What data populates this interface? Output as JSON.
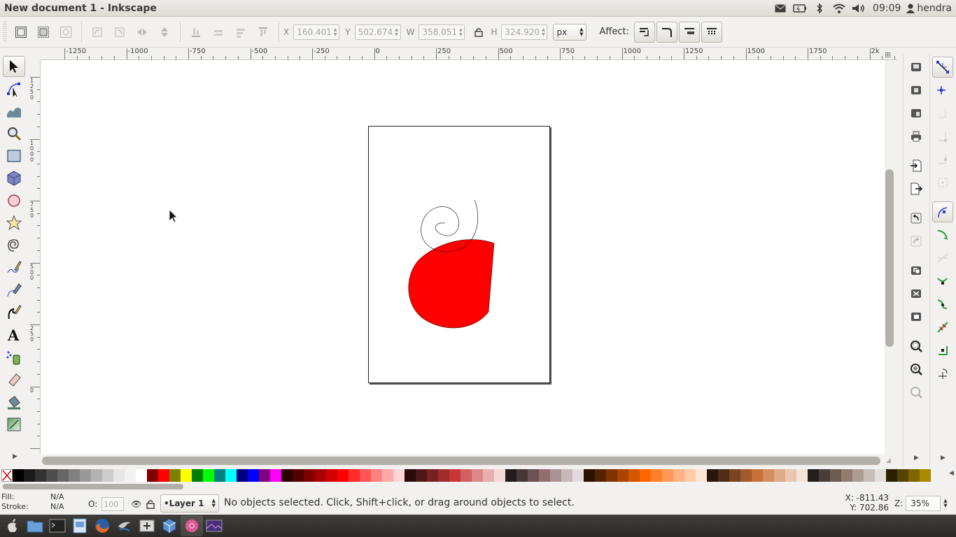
{
  "window": {
    "title": "New document 1 - Inkscape"
  },
  "tray": {
    "clock": "09:09",
    "user": "hendra"
  },
  "controls": {
    "x_label": "X",
    "x_value": "160.401",
    "y_label": "Y",
    "y_value": "502.674",
    "w_label": "W",
    "w_value": "358.051",
    "h_label": "H",
    "h_value": "324.920",
    "unit": "px",
    "affect_label": "Affect:"
  },
  "ruler": {
    "h_ticks": [
      "-1250",
      "-1000",
      "-750",
      "-500",
      "-250",
      "0",
      "250",
      "500",
      "750",
      "1000",
      "1250",
      "1500",
      "1750",
      "2k"
    ],
    "v_ticks": [
      "1250",
      "1000",
      "750",
      "500",
      "250",
      "0"
    ]
  },
  "statusbar": {
    "fill_label": "Fill:",
    "fill_value": "N/A",
    "stroke_label": "Stroke:",
    "stroke_value": "N/A",
    "opacity_label": "O:",
    "opacity_value": "100",
    "layer": "•Layer 1",
    "message": "No objects selected. Click, Shift+click, or drag around objects to select.",
    "x_coord": "X: -811.43",
    "y_coord": "Y:  702.86",
    "zoom_label": "Z:",
    "zoom_value": "35%"
  },
  "palette": [
    "#000000",
    "#1a1a1a",
    "#333333",
    "#4d4d4d",
    "#666666",
    "#808080",
    "#999999",
    "#b3b3b3",
    "#cccccc",
    "#e6e6e6",
    "#f2f2f2",
    "#ffffff",
    "#800000",
    "#ff0000",
    "#808000",
    "#ffff00",
    "#008000",
    "#00ff00",
    "#008080",
    "#00ffff",
    "#000080",
    "#0000ff",
    "#800080",
    "#ff00ff",
    "#2b0000",
    "#550000",
    "#800000",
    "#aa0000",
    "#d40000",
    "#ff0000",
    "#ff2a2a",
    "#ff5555",
    "#ff8080",
    "#ffaaaa",
    "#ffd5d5",
    "#280b0b",
    "#501616",
    "#782121",
    "#a02c2c",
    "#c83737",
    "#d35f5f",
    "#de8787",
    "#e9afaf",
    "#f4d7d7",
    "#241c1c",
    "#483737",
    "#6c5353",
    "#916f6f",
    "#ac9393",
    "#c8b7b7",
    "#e3dbdb",
    "#2b1100",
    "#552200",
    "#803300",
    "#aa4400",
    "#d45500",
    "#ff6600",
    "#ff7f2a",
    "#ff9955",
    "#ffb380",
    "#ffccaa",
    "#ffe6d5",
    "#28170b",
    "#502d16",
    "#784421",
    "#a05a2c",
    "#c87137",
    "#d38d5f",
    "#deaa87",
    "#e9c6af",
    "#f4e3d7",
    "#241f1c",
    "#483e37",
    "#6c5d53",
    "#917c6f",
    "#ac9d93",
    "#c8beb7",
    "#e3dedb",
    "#2b2200",
    "#554400",
    "#806600",
    "#aa8800"
  ],
  "shape": {
    "fill": "#ff0000",
    "stroke": "#000000"
  },
  "icons": {
    "tools": [
      "selector-icon",
      "node-icon",
      "tweak-icon",
      "zoom-icon",
      "rect-icon",
      "box3d-icon",
      "ellipse-icon",
      "star-icon",
      "spiral-icon",
      "pencil-icon",
      "pen-icon",
      "calligraphy-icon",
      "text-icon",
      "spray-icon",
      "eraser-icon",
      "paint-bucket-icon",
      "gradient-icon"
    ]
  }
}
